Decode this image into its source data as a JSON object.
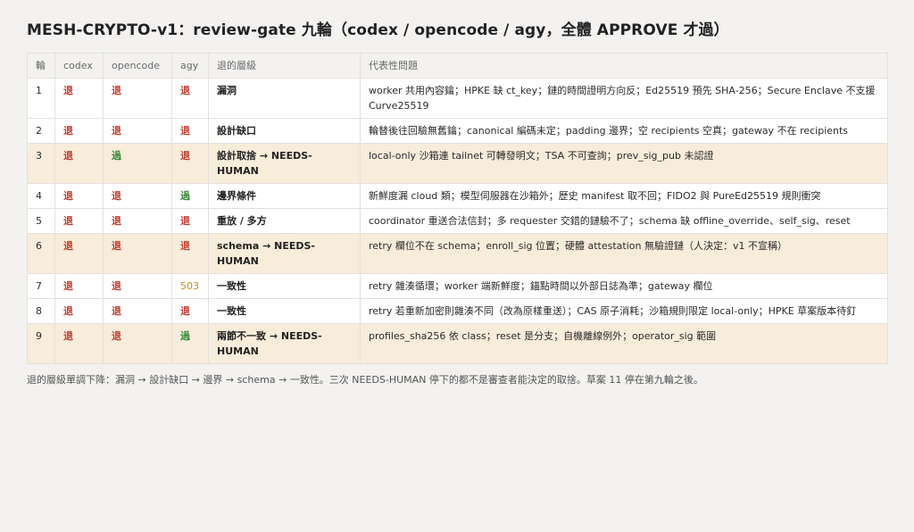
{
  "title": "MESH-CRYPTO-v1：review-gate 九輪（codex / opencode / agy，全體 APPROVE 才過）",
  "headers": [
    "輪",
    "codex",
    "opencode",
    "agy",
    "退的層級",
    "代表性問題"
  ],
  "rows": [
    {
      "round": "1",
      "codex": "退",
      "opencode": "退",
      "agy": "退",
      "level": "漏洞",
      "issues": "worker 共用內容鑰；HPKE 缺 ct_key；鏈的時間證明方向反；Ed25519 預先 SHA-256；Secure Enclave 不支援 Curve25519",
      "highlight": false
    },
    {
      "round": "2",
      "codex": "退",
      "opencode": "退",
      "agy": "退",
      "level": "設計缺口",
      "issues": "輪替後往回驗無舊鑰；canonical 編碼未定；padding 邊界；空 recipients 空真；gateway 不在 recipients",
      "highlight": false
    },
    {
      "round": "3",
      "codex": "退",
      "opencode": "過",
      "agy": "退",
      "level": "設計取捨 → NEEDS-HUMAN",
      "issues": "local-only 沙箱連 tailnet 可轉發明文；TSA 不可查詢；prev_sig_pub 未認證",
      "highlight": true
    },
    {
      "round": "4",
      "codex": "退",
      "opencode": "退",
      "agy": "過",
      "level": "邊界條件",
      "issues": "新鮮度漏 cloud 類；模型伺服器在沙箱外；歷史 manifest 取不回；FIDO2 與 PureEd25519 規則衝突",
      "highlight": false
    },
    {
      "round": "5",
      "codex": "退",
      "opencode": "退",
      "agy": "退",
      "level": "重放 / 多方",
      "issues": "coordinator 重送合法信封；多 requester 交錯的鏈驗不了；schema 缺 offline_override、self_sig、reset",
      "highlight": false
    },
    {
      "round": "6",
      "codex": "退",
      "opencode": "退",
      "agy": "退",
      "level": "schema → NEEDS-HUMAN",
      "issues": "retry 欄位不在 schema；enroll_sig 位置；硬體 attestation 無驗證鏈（人決定：v1 不宣稱）",
      "highlight": true
    },
    {
      "round": "7",
      "codex": "退",
      "opencode": "退",
      "agy": "503",
      "level": "一致性",
      "issues": "retry 雜湊循環；worker 端新鮮度；錨點時間以外部日誌為準；gateway 欄位",
      "highlight": false
    },
    {
      "round": "8",
      "codex": "退",
      "opencode": "退",
      "agy": "退",
      "level": "一致性",
      "issues": "retry 若重新加密則雜湊不同（改為原樣重送）；CAS 原子消耗；沙箱規則限定 local-only；HPKE 草案版本待釘",
      "highlight": false
    },
    {
      "round": "9",
      "codex": "退",
      "opencode": "退",
      "agy": "過",
      "level": "兩節不一致 → NEEDS-HUMAN",
      "issues": "profiles_sha256 依 class；reset 是分支；自機離線例外；operator_sig 範圍",
      "highlight": true
    }
  ],
  "note": "退的層級單調下降：漏洞 → 設計缺口 → 邊界 → schema → 一致性。三次 NEEDS-HUMAN 停下的都不是審查者能決定的取捨。草案 11 停在第九輪之後。",
  "colors": {
    "reject": "#c0392b",
    "pass": "#3b8a3b",
    "error": "#c88a1c",
    "highlight_row": "#f8ecdb"
  }
}
